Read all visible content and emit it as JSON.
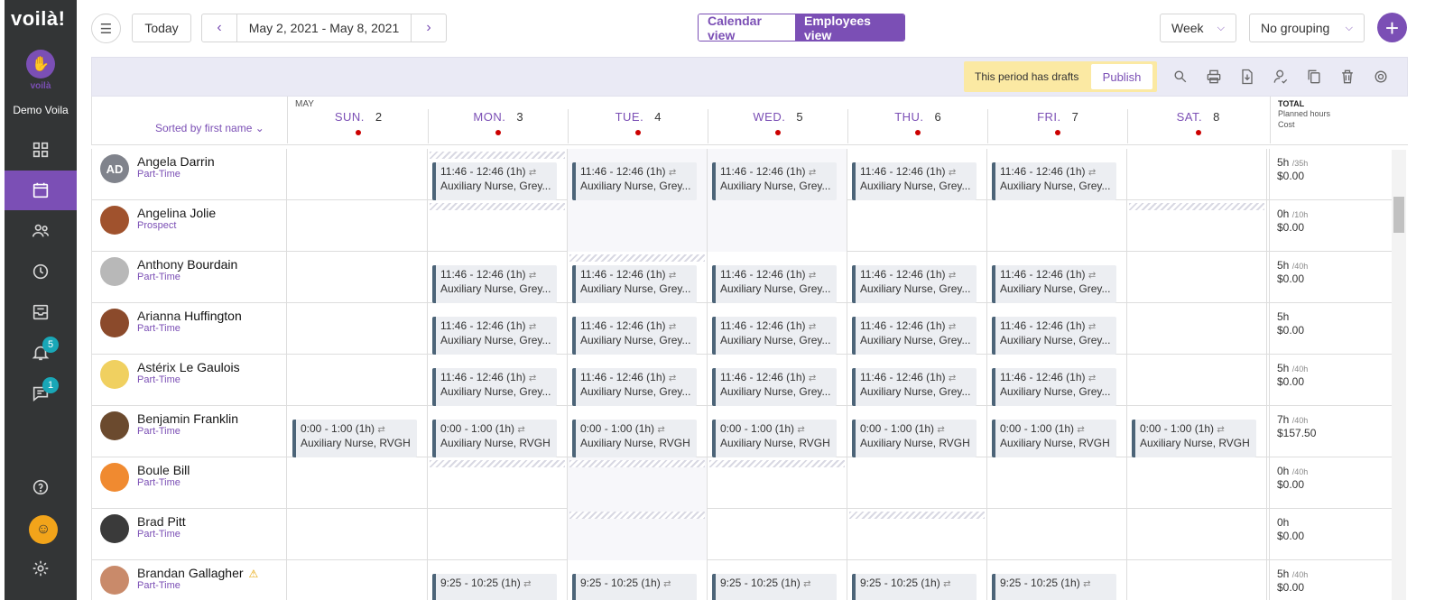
{
  "app": {
    "logo": "voilà!",
    "org_sub": "voilà",
    "org_name": "Demo Voila"
  },
  "sidebar": {
    "items": [
      {
        "icon": "dashboard-icon"
      },
      {
        "icon": "calendar-icon",
        "active": true
      },
      {
        "icon": "people-icon"
      },
      {
        "icon": "clock-icon"
      },
      {
        "icon": "inbox-icon"
      },
      {
        "icon": "bell-icon",
        "badge": "5"
      },
      {
        "icon": "chat-icon",
        "badge": "1"
      },
      {
        "icon": "help-icon"
      },
      {
        "icon": "user-avatar-icon"
      },
      {
        "icon": "settings-icon"
      }
    ]
  },
  "topbar": {
    "today": "Today",
    "date_range": "May 2, 2021 - May 8, 2021",
    "calendar_view": "Calendar view",
    "employees_view": "Employees view",
    "period": "Week",
    "grouping": "No grouping"
  },
  "toolbar": {
    "drafts_msg": "This period has drafts",
    "publish": "Publish"
  },
  "grid": {
    "sorted_by": "Sorted by first name",
    "month": "MAY",
    "days": [
      {
        "name": "SUN.",
        "date": "2"
      },
      {
        "name": "MON.",
        "date": "3"
      },
      {
        "name": "TUE.",
        "date": "4"
      },
      {
        "name": "WED.",
        "date": "5"
      },
      {
        "name": "THU.",
        "date": "6"
      },
      {
        "name": "FRI.",
        "date": "7"
      },
      {
        "name": "SAT.",
        "date": "8"
      }
    ],
    "total_title": "TOTAL",
    "total_sub1": "Planned hours",
    "total_sub2": "Cost"
  },
  "shift_a": {
    "time": "11:46 - 12:46 (1h)",
    "role": "Auxiliary Nurse, Grey..."
  },
  "shift_b": {
    "time": "0:00 - 1:00 (1h)",
    "role": "Auxiliary Nurse, RVGH"
  },
  "shift_c": {
    "time": "9:25 - 10:25 (1h)"
  },
  "employees": [
    {
      "first": "Angela",
      "last": "Darrin",
      "role": "Part-Time",
      "initials": "AD",
      "hours": "5h",
      "max": "/35h",
      "cost": "$0.00"
    },
    {
      "first": "Angelina",
      "last": "Jolie",
      "role": "Prospect",
      "hours": "0h",
      "max": "/10h",
      "cost": "$0.00"
    },
    {
      "first": "Anthony",
      "last": "Bourdain",
      "role": "Part-Time",
      "hours": "5h",
      "max": "/40h",
      "cost": "$0.00"
    },
    {
      "first": "Arianna",
      "last": "Huffington",
      "role": "Part-Time",
      "hours": "5h",
      "max": "",
      "cost": "$0.00"
    },
    {
      "first": "Astérix",
      "last": "Le Gaulois",
      "role": "Part-Time",
      "hours": "5h",
      "max": "/40h",
      "cost": "$0.00"
    },
    {
      "first": "Benjamin",
      "last": "Franklin",
      "role": "Part-Time",
      "hours": "7h",
      "max": "/40h",
      "cost": "$157.50"
    },
    {
      "first": "Boule",
      "last": "Bill",
      "role": "Part-Time",
      "hours": "0h",
      "max": "/40h",
      "cost": "$0.00"
    },
    {
      "first": "Brad",
      "last": "Pitt",
      "role": "Part-Time",
      "hours": "0h",
      "max": "",
      "cost": "$0.00"
    },
    {
      "first": "Brandan",
      "last": "Gallagher",
      "role": "Part-Time",
      "hours": "5h",
      "max": "/40h",
      "cost": "$0.00"
    }
  ]
}
